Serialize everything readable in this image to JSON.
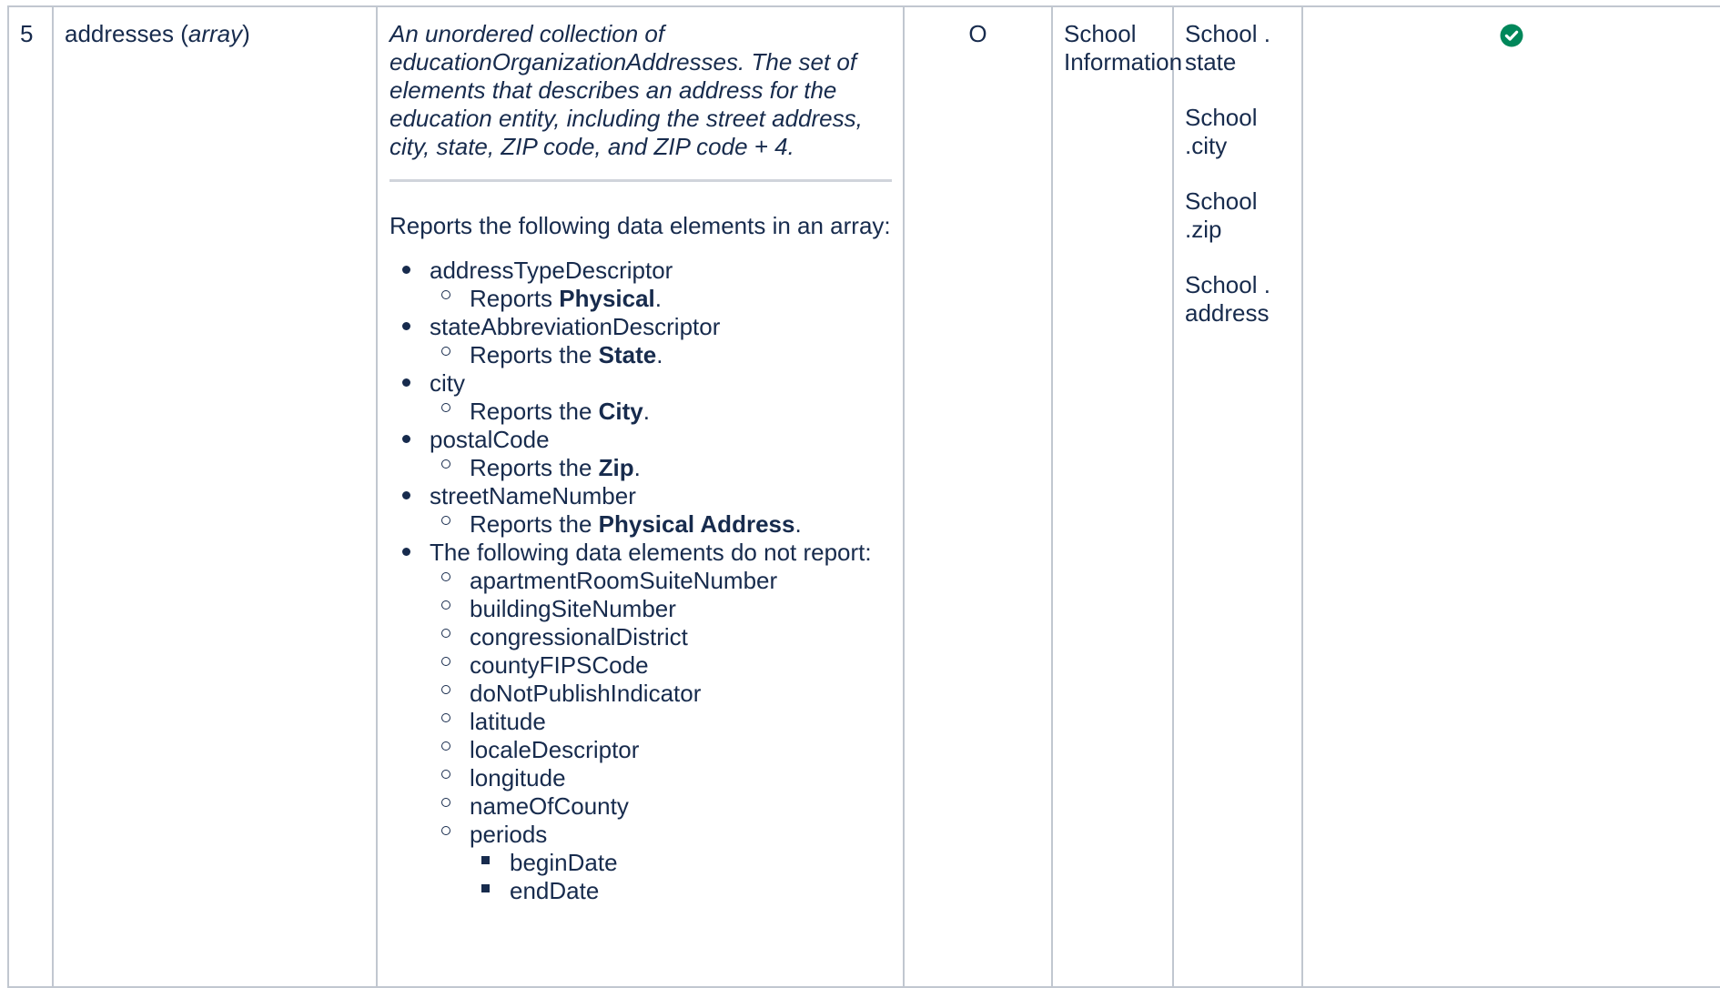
{
  "row": {
    "number": "5",
    "element": {
      "name": "addresses",
      "open_paren": "(",
      "type": "array",
      "close_paren": ")"
    },
    "description": {
      "definition_prefix": "An unordered collection of ",
      "definition_term": "educationOrganizationAddresses",
      "definition_suffix": ". The set of elements that describes an address for the education entity, including the street address, city, state, ZIP code, and ZIP code + 4.",
      "intro": "Reports the following data elements in an array:",
      "items": [
        {
          "name": "addressTypeDescriptor",
          "note_prefix": "Reports ",
          "note_bold": "Physical",
          "note_suffix": "."
        },
        {
          "name": "stateAbbreviationDescriptor",
          "note_prefix": "Reports the ",
          "note_bold": "State",
          "note_suffix": "."
        },
        {
          "name": "city",
          "note_prefix": "Reports the ",
          "note_bold": "City",
          "note_suffix": "."
        },
        {
          "name": "postalCode",
          "note_prefix": "Reports the ",
          "note_bold": "Zip",
          "note_suffix": "."
        },
        {
          "name": "streetNameNumber",
          "note_prefix": "Reports the ",
          "note_bold": "Physical Address",
          "note_suffix": "."
        }
      ],
      "not_reported_label": "The following data elements do not report:",
      "not_reported": [
        "apartmentRoomSuiteNumber",
        "buildingSiteNumber",
        "congressionalDistrict",
        "countyFIPSCode",
        "doNotPublishIndicator",
        "latitude",
        "localeDescriptor",
        "longitude",
        "nameOfCounty",
        "periods"
      ],
      "periods_children": [
        "beginDate",
        "endDate"
      ]
    },
    "optionality": "O",
    "source_screen": "School Information",
    "source_fields": [
      "School . state",
      "School .city",
      "School .zip",
      "School . address"
    ],
    "status_icon": "check-circle-icon",
    "status_color": "#00875a"
  }
}
